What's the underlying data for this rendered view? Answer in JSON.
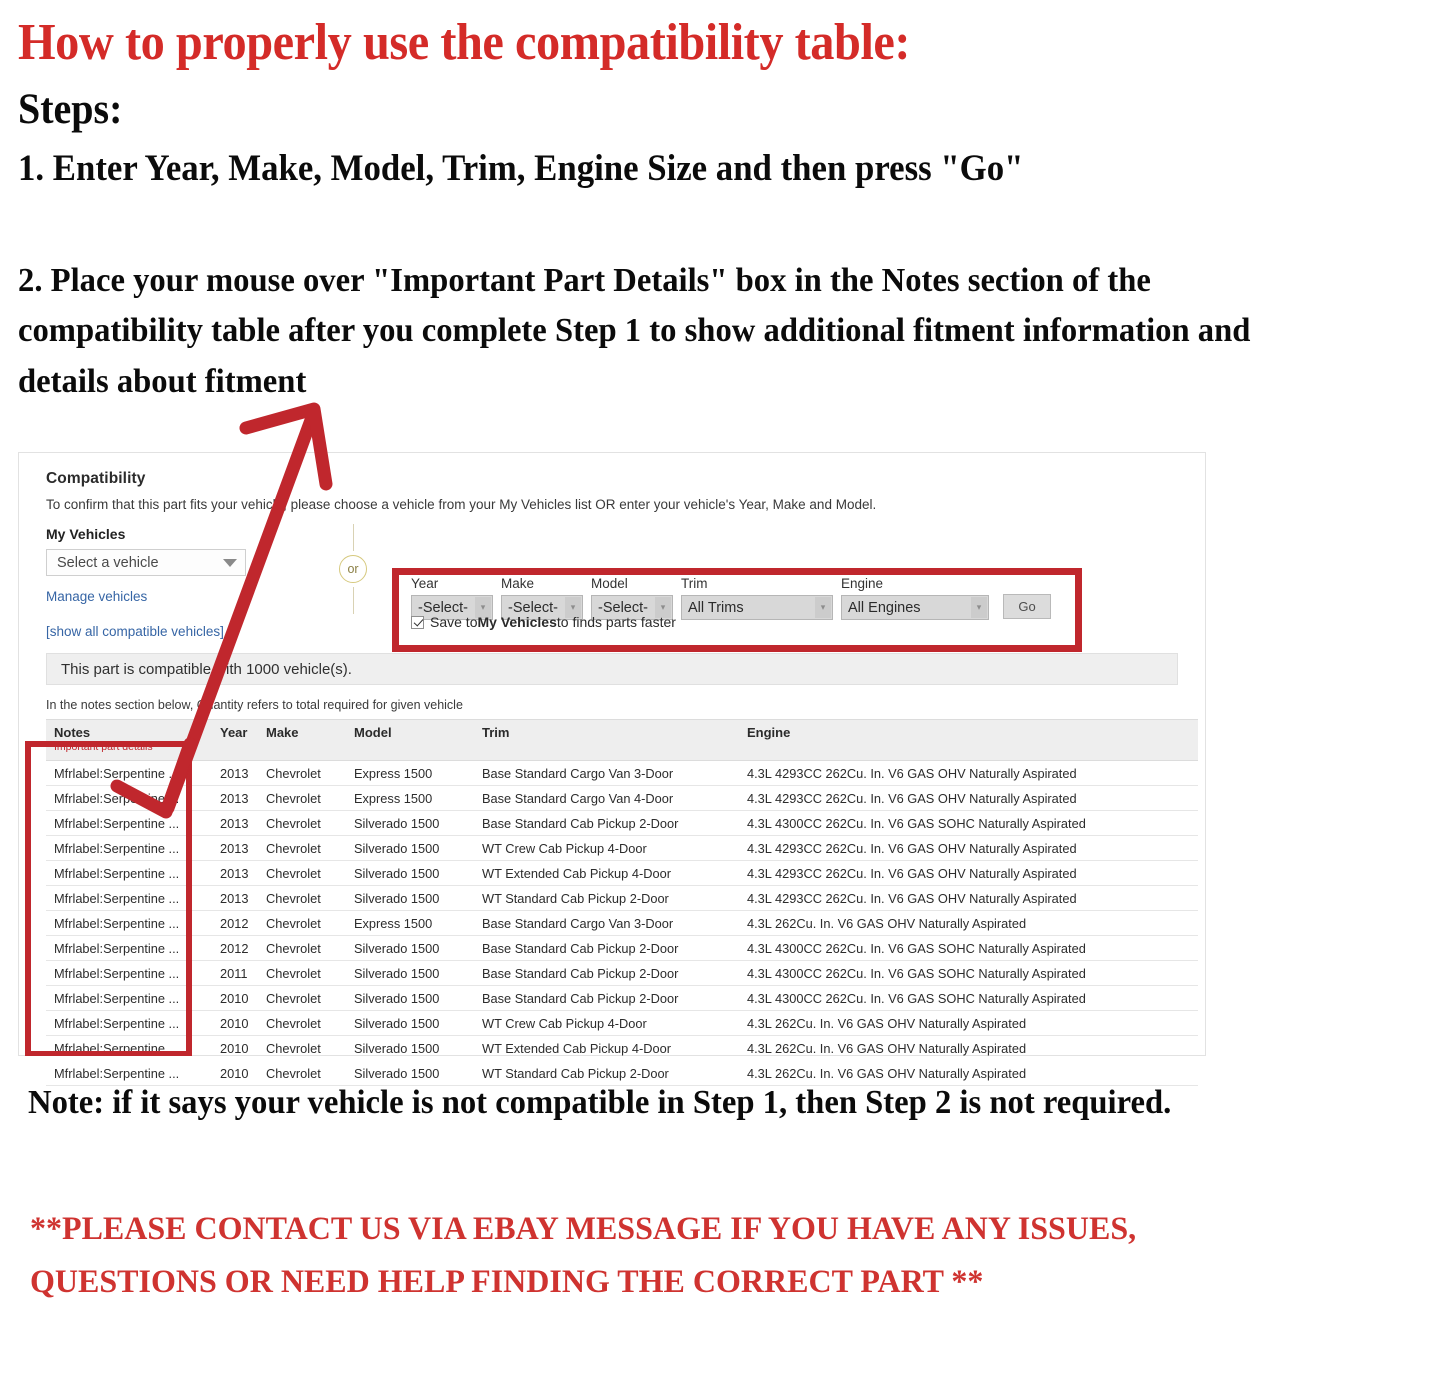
{
  "hero": {
    "title": "How to properly use the compatibility table:",
    "steps_label": "Steps:",
    "step1": "1. Enter Year, Make, Model, Trim, Engine Size and then press \"Go\"",
    "step2": "2. Place your mouse over \"Important Part Details\" box in the Notes section of the compatibility table after you complete Step 1 to show additional fitment information and details about fitment"
  },
  "footer": {
    "note": "Note: if it says your vehicle is not compatible in Step 1, then Step 2 is not required.",
    "contact": "**PLEASE CONTACT US VIA EBAY MESSAGE IF YOU HAVE ANY ISSUES, QUESTIONS OR NEED HELP FINDING THE CORRECT PART **"
  },
  "panel": {
    "title": "Compatibility",
    "subtitle": "To confirm that this part fits your vehicle, please choose a vehicle from your My Vehicles list OR enter your vehicle's Year, Make and Model.",
    "my_vehicles_label": "My Vehicles",
    "my_vehicles_value": "Select a vehicle",
    "manage_vehicles_link": "Manage vehicles",
    "or_label": "or",
    "show_all_link": "[show all compatible vehicles]",
    "compat_bar": "This part is compatible with 1000 vehicle(s).",
    "qty_note": "In the notes section below, Quantity refers to total required for given vehicle",
    "form": {
      "year": {
        "label": "Year",
        "value": "-Select-"
      },
      "make": {
        "label": "Make",
        "value": "-Select-"
      },
      "model": {
        "label": "Model",
        "value": "-Select-"
      },
      "trim": {
        "label": "Trim",
        "value": "All Trims"
      },
      "engine": {
        "label": "Engine",
        "value": "All Engines"
      },
      "go_label": "Go",
      "save_prefix": "Save to ",
      "save_bold": "My Vehicles",
      "save_suffix": " to finds parts faster"
    }
  },
  "table": {
    "headers": {
      "notes": "Notes",
      "notes_sub": "Important part details",
      "year": "Year",
      "make": "Make",
      "model": "Model",
      "trim": "Trim",
      "engine": "Engine"
    },
    "rows": [
      {
        "notes": "Mfrlabel:Serpentine ...",
        "year": "2013",
        "make": "Chevrolet",
        "model": "Express 1500",
        "trim": "Base Standard Cargo Van 3-Door",
        "engine": "4.3L 4293CC 262Cu. In. V6 GAS OHV Naturally Aspirated"
      },
      {
        "notes": "Mfrlabel:Serpentine ...",
        "year": "2013",
        "make": "Chevrolet",
        "model": "Express 1500",
        "trim": "Base Standard Cargo Van 4-Door",
        "engine": "4.3L 4293CC 262Cu. In. V6 GAS OHV Naturally Aspirated"
      },
      {
        "notes": "Mfrlabel:Serpentine ...",
        "year": "2013",
        "make": "Chevrolet",
        "model": "Silverado 1500",
        "trim": "Base Standard Cab Pickup 2-Door",
        "engine": "4.3L 4300CC 262Cu. In. V6 GAS SOHC Naturally Aspirated"
      },
      {
        "notes": "Mfrlabel:Serpentine ...",
        "year": "2013",
        "make": "Chevrolet",
        "model": "Silverado 1500",
        "trim": "WT Crew Cab Pickup 4-Door",
        "engine": "4.3L 4293CC 262Cu. In. V6 GAS OHV Naturally Aspirated"
      },
      {
        "notes": "Mfrlabel:Serpentine ...",
        "year": "2013",
        "make": "Chevrolet",
        "model": "Silverado 1500",
        "trim": "WT Extended Cab Pickup 4-Door",
        "engine": "4.3L 4293CC 262Cu. In. V6 GAS OHV Naturally Aspirated"
      },
      {
        "notes": "Mfrlabel:Serpentine ...",
        "year": "2013",
        "make": "Chevrolet",
        "model": "Silverado 1500",
        "trim": "WT Standard Cab Pickup 2-Door",
        "engine": "4.3L 4293CC 262Cu. In. V6 GAS OHV Naturally Aspirated"
      },
      {
        "notes": "Mfrlabel:Serpentine ...",
        "year": "2012",
        "make": "Chevrolet",
        "model": "Express 1500",
        "trim": "Base Standard Cargo Van 3-Door",
        "engine": "4.3L 262Cu. In. V6 GAS OHV Naturally Aspirated"
      },
      {
        "notes": "Mfrlabel:Serpentine ...",
        "year": "2012",
        "make": "Chevrolet",
        "model": "Silverado 1500",
        "trim": "Base Standard Cab Pickup 2-Door",
        "engine": "4.3L 4300CC 262Cu. In. V6 GAS SOHC Naturally Aspirated"
      },
      {
        "notes": "Mfrlabel:Serpentine ...",
        "year": "2011",
        "make": "Chevrolet",
        "model": "Silverado 1500",
        "trim": "Base Standard Cab Pickup 2-Door",
        "engine": "4.3L 4300CC 262Cu. In. V6 GAS SOHC Naturally Aspirated"
      },
      {
        "notes": "Mfrlabel:Serpentine ...",
        "year": "2010",
        "make": "Chevrolet",
        "model": "Silverado 1500",
        "trim": "Base Standard Cab Pickup 2-Door",
        "engine": "4.3L 4300CC 262Cu. In. V6 GAS SOHC Naturally Aspirated"
      },
      {
        "notes": "Mfrlabel:Serpentine ...",
        "year": "2010",
        "make": "Chevrolet",
        "model": "Silverado 1500",
        "trim": "WT Crew Cab Pickup 4-Door",
        "engine": "4.3L 262Cu. In. V6 GAS OHV Naturally Aspirated"
      },
      {
        "notes": "Mfrlabel:Serpentine ...",
        "year": "2010",
        "make": "Chevrolet",
        "model": "Silverado 1500",
        "trim": "WT Extended Cab Pickup 4-Door",
        "engine": "4.3L 262Cu. In. V6 GAS OHV Naturally Aspirated"
      },
      {
        "notes": "Mfrlabel:Serpentine ...",
        "year": "2010",
        "make": "Chevrolet",
        "model": "Silverado 1500",
        "trim": "WT Standard Cab Pickup 2-Door",
        "engine": "4.3L 262Cu. In. V6 GAS OHV Naturally Aspirated"
      }
    ]
  },
  "colors": {
    "red": "#c0272d",
    "heading_red": "#d42b28",
    "link_blue": "#3665a5"
  }
}
